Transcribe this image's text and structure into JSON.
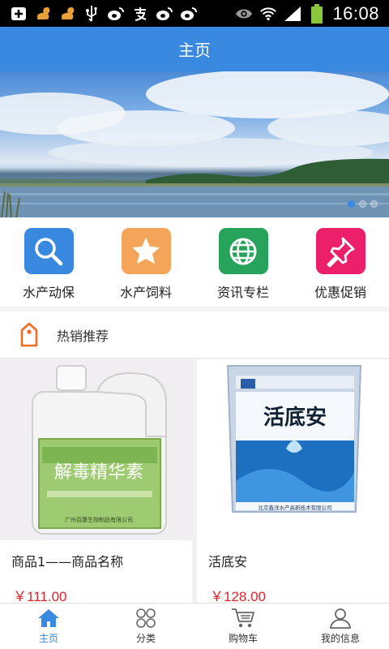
{
  "status_bar": {
    "time": "16:08",
    "left_icons": [
      "add-icon",
      "squirrel-icon",
      "squirrel-icon",
      "usb-icon",
      "weibo-icon",
      "alipay-icon",
      "weibo-icon",
      "weibo-icon"
    ],
    "right_icons": [
      "eye-icon",
      "wifi-icon",
      "signal-icon",
      "battery-icon"
    ]
  },
  "header": {
    "title": "主页"
  },
  "banner": {
    "slide_count": 3,
    "active_slide": 1
  },
  "categories": [
    {
      "label": "水产动保",
      "icon": "search-icon",
      "color": "#3a89e0"
    },
    {
      "label": "水产饲料",
      "icon": "star-icon",
      "color": "#f4a55a"
    },
    {
      "label": "资讯专栏",
      "icon": "globe-icon",
      "color": "#27a35c"
    },
    {
      "label": "优惠促销",
      "icon": "pin-icon",
      "color": "#ec1f6a"
    }
  ],
  "hot_section": {
    "label": "热销推荐",
    "icon": "tag-icon",
    "color": "#f26d21"
  },
  "products": [
    {
      "name": "商品1——商品名称",
      "price": "￥111.00",
      "image_text": {
        "main": "解毒精华素",
        "label_bottom": "广州百康生物制品有限公司"
      }
    },
    {
      "name": "活底安",
      "price": "￥128.00",
      "image_text": {
        "main": "活底安",
        "label_bottom": "北京鑫洋水产高新技术有限公司"
      }
    }
  ],
  "tabs": [
    {
      "label": "主页",
      "icon": "home-icon",
      "active": true
    },
    {
      "label": "分类",
      "icon": "category-icon",
      "active": false
    },
    {
      "label": "购物车",
      "icon": "cart-icon",
      "active": false
    },
    {
      "label": "我的信息",
      "icon": "user-icon",
      "active": false
    }
  ],
  "colors": {
    "primary": "#3a89e0",
    "price": "#e0252c",
    "background": "#f2f2f2"
  }
}
